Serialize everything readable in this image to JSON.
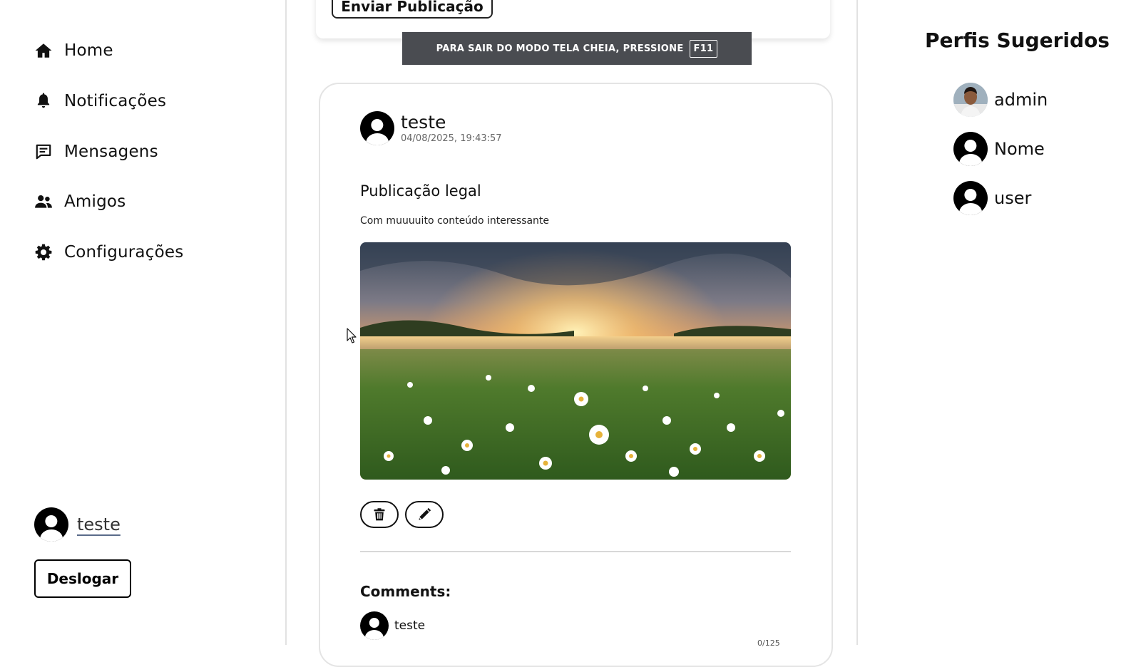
{
  "sidebar": {
    "items": [
      {
        "label": "Home",
        "icon": "home-icon"
      },
      {
        "label": "Notificações",
        "icon": "bell-icon"
      },
      {
        "label": "Mensagens",
        "icon": "message-icon"
      },
      {
        "label": "Amigos",
        "icon": "users-icon"
      },
      {
        "label": "Configurações",
        "icon": "gear-icon"
      }
    ],
    "current_user": "teste",
    "logout_label": "Deslogar"
  },
  "composer": {
    "send_label": "Enviar Publicação"
  },
  "fullscreen_banner": {
    "text": "PARA SAIR DO MODO TELA CHEIA, PRESSIONE",
    "key": "F11"
  },
  "post": {
    "author": "teste",
    "date": "04/08/2025, 19:43:57",
    "title": "Publicação legal",
    "body": "Com muuuuito conteúdo interessante",
    "image": "landscape-photo",
    "actions": [
      "delete-icon",
      "edit-icon"
    ],
    "comments_title": "Comments:",
    "comments": [
      {
        "author": "teste"
      }
    ],
    "char_count": "0/125"
  },
  "suggestions": {
    "title": "Perfis Sugeridos",
    "profiles": [
      {
        "name": "admin",
        "avatar": "photo"
      },
      {
        "name": "Nome",
        "avatar": "default"
      },
      {
        "name": "user",
        "avatar": "default"
      }
    ]
  },
  "colors": {
    "text": "#111111",
    "banner_bg": "#4a4c51",
    "border": "#e4e4e4"
  }
}
